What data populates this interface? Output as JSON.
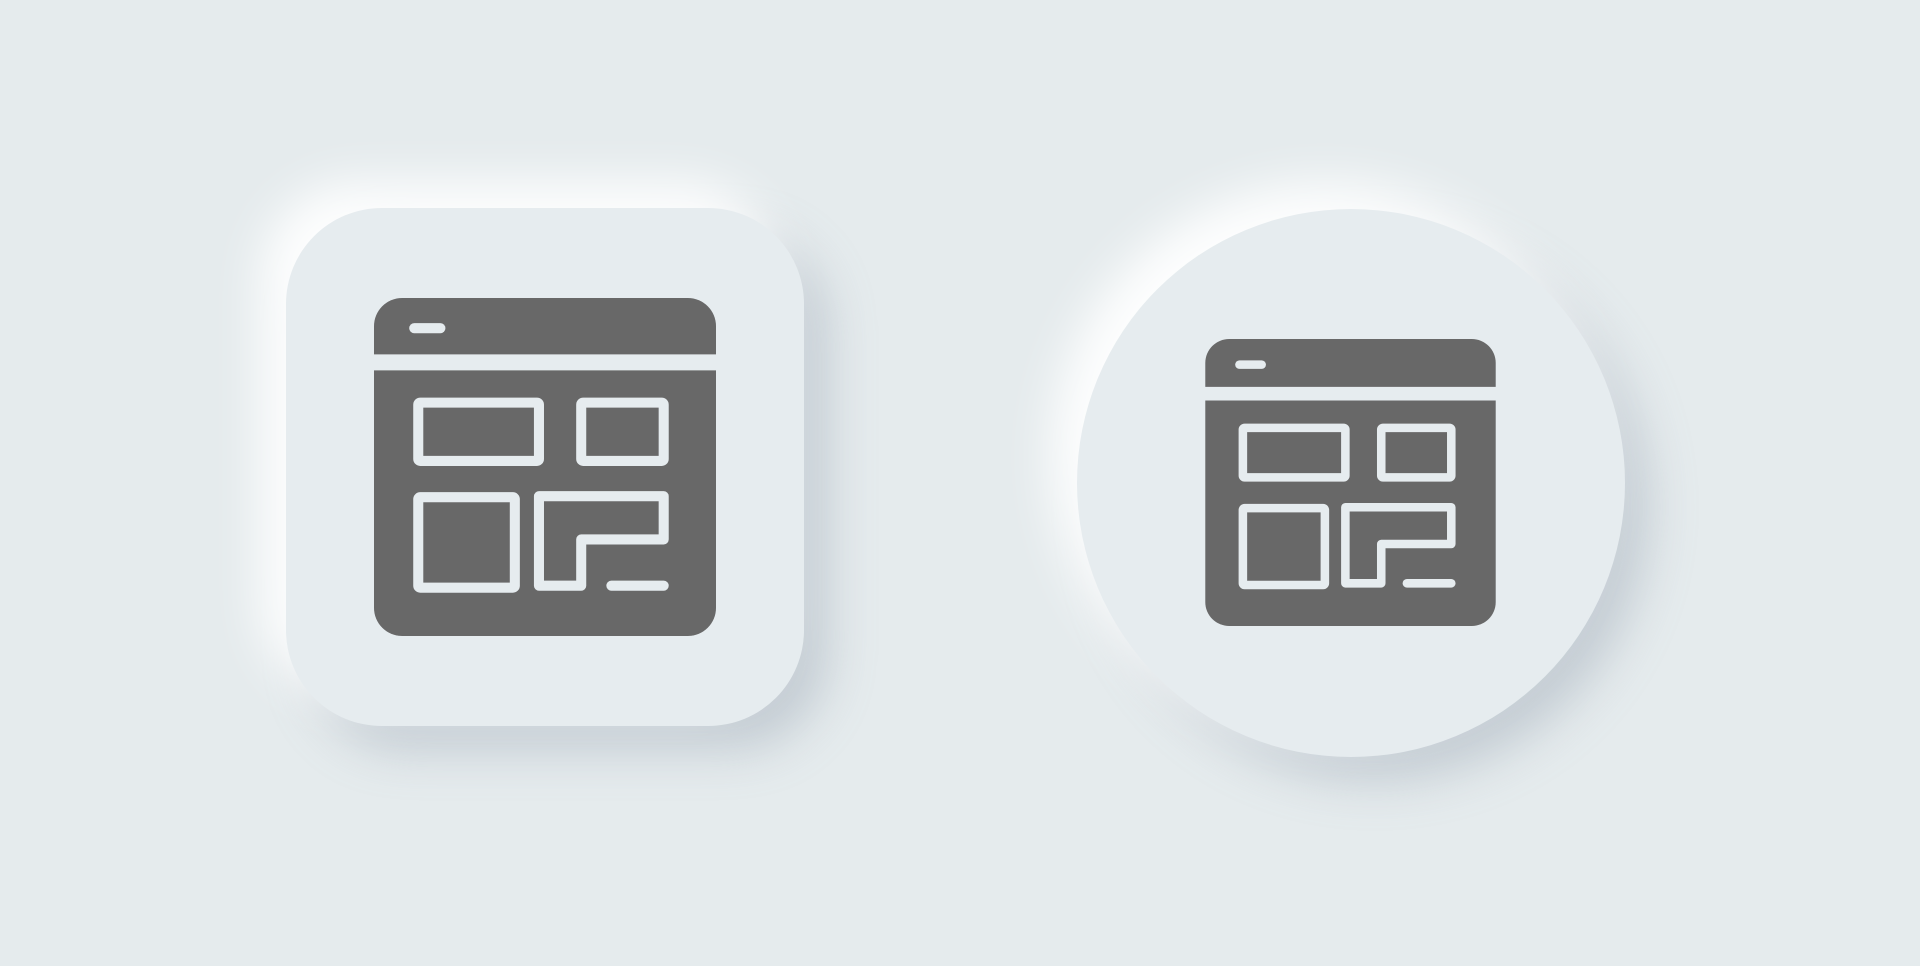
{
  "background_color": "#e5ebed",
  "tile_color": "#e6ecef",
  "icon_color": "#686868",
  "icon_cutout_color": "#e6ecef",
  "icons": [
    {
      "shape": "rounded-square",
      "icon": "web-layout-icon"
    },
    {
      "shape": "circle",
      "icon": "web-layout-icon"
    }
  ]
}
